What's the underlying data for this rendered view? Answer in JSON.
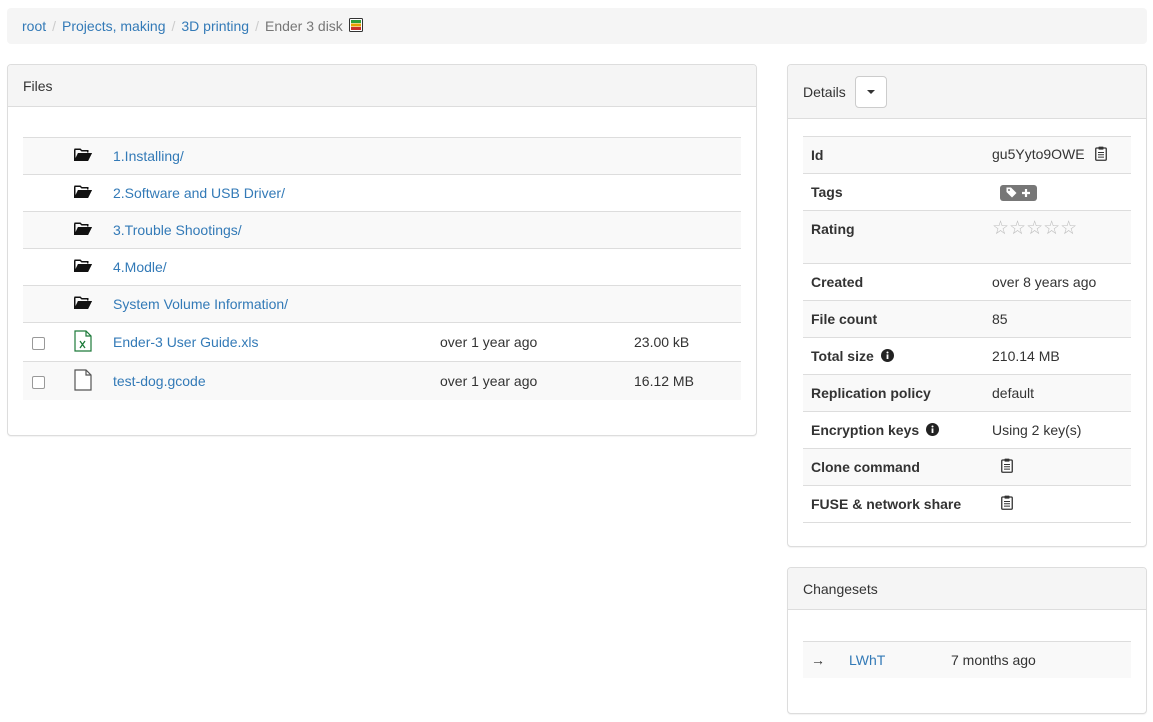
{
  "breadcrumb": {
    "items": [
      "root",
      "Projects, making",
      "3D printing"
    ],
    "current": "Ender 3 disk",
    "separator": "/"
  },
  "files": {
    "title": "Files",
    "directories": [
      {
        "name": "1.Installing/"
      },
      {
        "name": "2.Software and USB Driver/"
      },
      {
        "name": "3.Trouble Shootings/"
      },
      {
        "name": "4.Modle/"
      },
      {
        "name": "System Volume Information/"
      }
    ],
    "file_rows": [
      {
        "name": "Ender-3 User Guide.xls",
        "modified": "over 1 year ago",
        "size": "23.00 kB",
        "icon": "excel-file-icon"
      },
      {
        "name": "test-dog.gcode",
        "modified": "over 1 year ago",
        "size": "16.12 MB",
        "icon": "file-icon"
      }
    ]
  },
  "details": {
    "title": "Details",
    "rows": {
      "id": {
        "label": "Id",
        "value": "gu5Yyto9OWE"
      },
      "tags": {
        "label": "Tags"
      },
      "rating": {
        "label": "Rating",
        "stars": "☆☆☆☆☆",
        "value": 0,
        "max": 5
      },
      "created": {
        "label": "Created",
        "value": "over 8 years ago"
      },
      "file_count": {
        "label": "File count",
        "value": "85"
      },
      "total_size": {
        "label": "Total size",
        "value": "210.14 MB"
      },
      "replication": {
        "label": "Replication policy",
        "value": "default"
      },
      "encryption": {
        "label": "Encryption keys",
        "value": "Using 2 key(s)"
      },
      "clone": {
        "label": "Clone command"
      },
      "fuse": {
        "label": "FUSE & network share"
      }
    }
  },
  "changesets": {
    "title": "Changesets",
    "items": [
      {
        "arrow": "→",
        "id": "LWhT",
        "time": "7 months ago"
      }
    ]
  },
  "colors": {
    "link": "#337ab7",
    "panel_heading_bg": "#f5f5f5",
    "border": "#dddddd",
    "tag_bg": "#777777",
    "excel_green": "#1d7a3a"
  }
}
